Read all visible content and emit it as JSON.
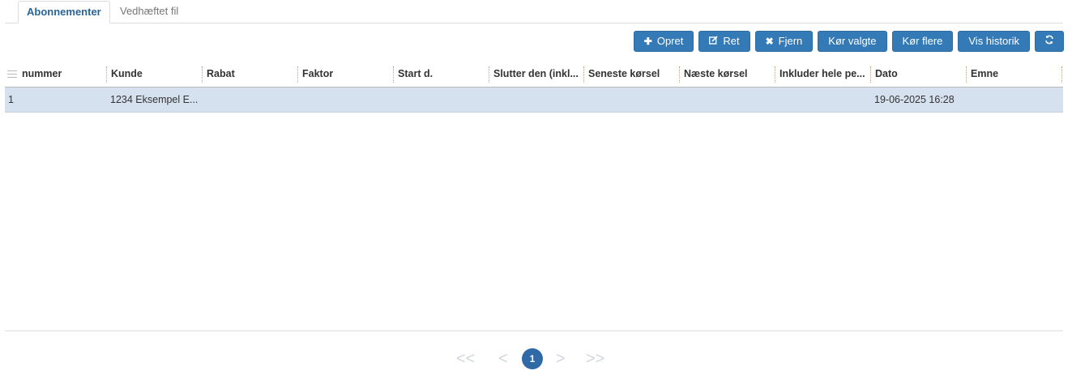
{
  "tabs": [
    {
      "label": "Abonnementer",
      "active": true
    },
    {
      "label": "Vedhæftet fil",
      "active": false
    }
  ],
  "toolbar": {
    "opret": {
      "label": "Opret",
      "icon": "plus-icon"
    },
    "ret": {
      "label": "Ret",
      "icon": "edit-icon"
    },
    "fjern": {
      "label": "Fjern",
      "icon": "close-icon"
    },
    "kor_valgte": {
      "label": "Kør valgte"
    },
    "kor_flere": {
      "label": "Kør flere"
    },
    "vis_historik": {
      "label": "Vis historik"
    },
    "refresh": {
      "icon": "refresh-icon"
    }
  },
  "grid": {
    "columns": [
      "nummer",
      "Kunde",
      "Rabat",
      "Faktor",
      "Start d.",
      "Slutter den (inkl...",
      "Seneste kørsel",
      "Næste kørsel",
      "Inkluder hele pe...",
      "Dato",
      "Emne"
    ],
    "rows": [
      [
        "1",
        "1234 Eksempel E...",
        "",
        "",
        "",
        "",
        "",
        "",
        "",
        "19-06-2025 16:28",
        ""
      ]
    ]
  },
  "pager": {
    "first": "<<",
    "prev": "<",
    "current": "1",
    "next": ">",
    "last": ">>"
  },
  "colors": {
    "accent": "#337ab7",
    "selected_row": "#d5e1ee",
    "page_current": "#2f6aa7"
  }
}
